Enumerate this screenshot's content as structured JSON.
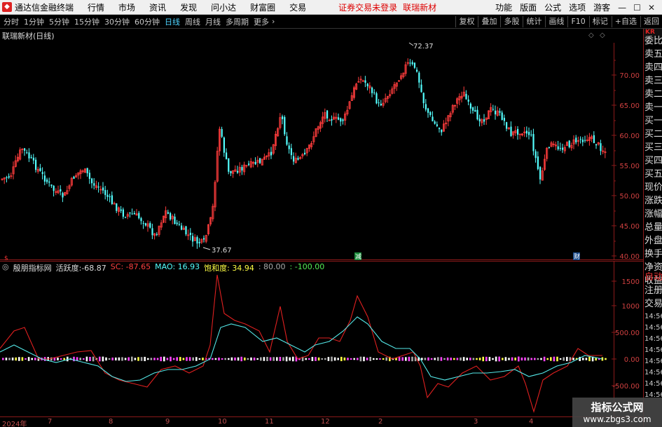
{
  "menubar": {
    "app_title": "通达信金融终端",
    "items": [
      "行情",
      "市场",
      "资讯",
      "发现",
      "问小达",
      "财富圈",
      "交易"
    ],
    "alert": "证券交易未登录",
    "stock_name": "联瑞新材",
    "right_items": [
      "功能",
      "版面",
      "公式",
      "选项"
    ],
    "user": "游客"
  },
  "toolbar": {
    "periods": [
      "分时",
      "1分钟",
      "5分钟",
      "15分钟",
      "30分钟",
      "60分钟",
      "日线",
      "周线",
      "月线",
      "多周期",
      "更多"
    ],
    "active": "日线",
    "right_buttons": [
      "复权",
      "叠加",
      "多股",
      "统计",
      "画线",
      "F10",
      "标记",
      "+自选",
      "返回"
    ]
  },
  "price_chart": {
    "title": "联瑞新材(日线)",
    "high_label": "72.37",
    "low_label": "37.67",
    "markers": [
      "减",
      "财"
    ],
    "y_ticks": [
      "70.00",
      "65.00",
      "60.00",
      "55.00",
      "50.00",
      "45.00",
      "40.00"
    ],
    "colors": {
      "up": "#ff3c3c",
      "down": "#54ffff",
      "grid": "#8b1a1a"
    }
  },
  "indicator": {
    "name": "殷朋指标网",
    "huoyue_label": "活跃度",
    "huoyue_value": "-68.87",
    "sc_label": "SC",
    "sc_value": "-87.65",
    "mao_label": "MAO",
    "mao_value": "16.93",
    "bhd_label": "饱和度",
    "bhd_value": "34.94",
    "lv1": "80.00",
    "lv2": "-100.00",
    "y_ticks": [
      "1500",
      "1000",
      "500.00",
      "0.00",
      "-500.00"
    ]
  },
  "time_axis": [
    "2024年",
    "7",
    "8",
    "9",
    "10",
    "11",
    "12",
    "2",
    "3",
    "4"
  ],
  "side_panel": {
    "kr": "KR",
    "items": [
      "委比",
      "卖五",
      "卖四",
      "卖三",
      "卖二",
      "卖一",
      "买一",
      "买二",
      "买三",
      "买四",
      "买五",
      "现价",
      "涨跌",
      "涨幅",
      "总量",
      "外盘",
      "换手",
      "净资",
      "收益"
    ],
    "lower": [
      "自动",
      "注册",
      "交易"
    ],
    "times": [
      "14:56",
      "14:56",
      "14:56",
      "14:56",
      "14:56",
      "14:56",
      "14:56",
      "14:56"
    ]
  },
  "watermark": {
    "line1": "指标公式网",
    "line2": "www.zbgs3.com"
  }
}
